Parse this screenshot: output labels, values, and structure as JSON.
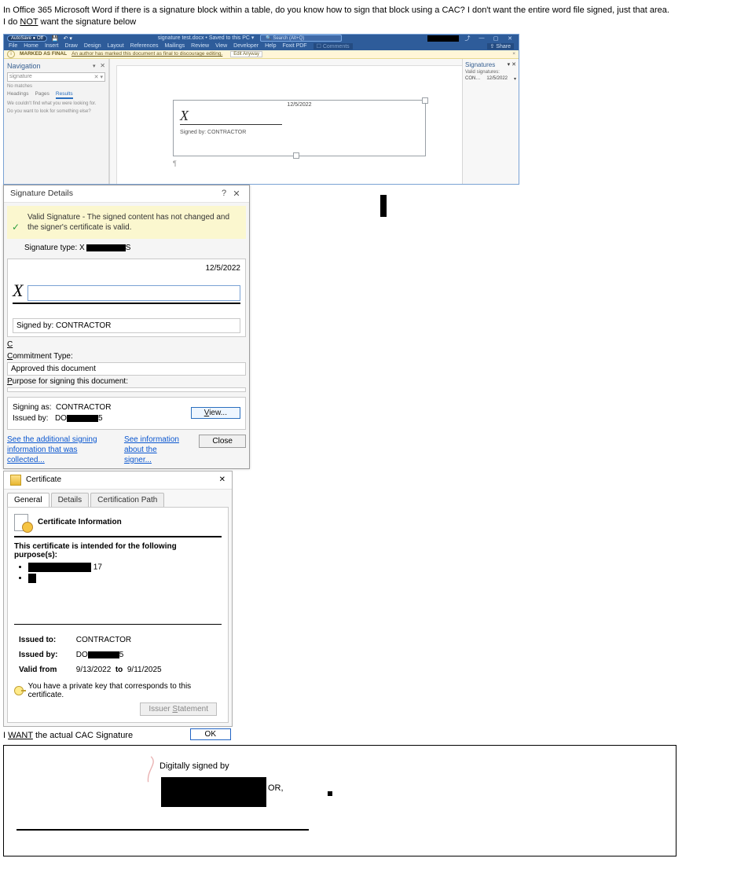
{
  "intro": {
    "line1": "In Office 365 Microsoft Word if there is a signature block within a table, do you know how to sign that block using a CAC? I don't want the entire word file signed, just that area.",
    "line2a": "I do ",
    "line2b": "NOT",
    "line2c": " want the signature below"
  },
  "word": {
    "autosave": "AutoSave ● Off",
    "doc_title": "signature test.docx • Saved to this PC ▾",
    "search_placeholder": "Search (Alt+Q)",
    "window_min": "—",
    "window_max": "▢",
    "window_close": "✕",
    "share_icon_label": "⤴",
    "ribbon": [
      "File",
      "Home",
      "Insert",
      "Draw",
      "Design",
      "Layout",
      "References",
      "Mailings",
      "Review",
      "View",
      "Developer",
      "Help",
      "Foxit PDF"
    ],
    "comments": "☐ Comments",
    "share": "⇪ Share",
    "marked_final_label": "MARKED AS FINAL",
    "marked_final_text": "An author has marked this document as final to discourage editing.",
    "edit_anyway": "Edit Anyway",
    "info_icon": "i",
    "close_x": "×",
    "nav": {
      "title": "Navigation",
      "chevron": "▾",
      "close": "✕",
      "search_value": "signature",
      "search_clear": "✕ ▾",
      "no_matches": "No matches",
      "tabs": {
        "headings": "Headings",
        "pages": "Pages",
        "results": "Results"
      },
      "msg1": "We couldn't find what you were looking for.",
      "msg2": "Do you want to look for something else?"
    },
    "sigpane": {
      "title": "Signatures",
      "chevron": "▾",
      "close": "✕",
      "valid_label": "Valid signatures:",
      "name": "CON…",
      "date": "12/5/2022",
      "row_chevron": "▾"
    },
    "sigblock": {
      "date": "12/5/2022",
      "x": "X",
      "signed_by": "Signed by: CONTRACTOR",
      "para": "¶"
    }
  },
  "sigdetails": {
    "title": "Signature Details",
    "help": "?",
    "close": "✕",
    "valid_icon": "✓",
    "valid_text": "Valid Signature - The signed content has not changed and the signer's certificate is valid.",
    "sig_type_label": "Signature type: X",
    "sig_type_tail": "S",
    "date": "12/5/2022",
    "x": "X",
    "signed_by": "Signed by: CONTRACTOR",
    "commitment_label": "Commitment Type:",
    "commitment_value": "Approved this document",
    "purpose_label": "Purpose for signing this document:",
    "purpose_value": "",
    "signing_as_label": "Signing as:",
    "signing_as_value": "CONTRACTOR",
    "issued_by_label": "Issued by:",
    "issued_by_prefix": "DO",
    "issued_by_tail": "5",
    "view_btn": "View...",
    "link1": "See the additional signing information that was collected...",
    "link2": "See information about the signer...",
    "close_btn": "Close"
  },
  "cert": {
    "title": "Certificate",
    "close": "✕",
    "tabs": {
      "general": "General",
      "details": "Details",
      "path": "Certification Path"
    },
    "info_head": "Certificate Information",
    "purpose_intro": "This certificate is intended for the following purpose(s):",
    "purpose_tail": "17",
    "issued_to_label": "Issued to:",
    "issued_to_value": "CONTRACTOR",
    "issued_by_label": "Issued by:",
    "issued_by_prefix": "DO",
    "issued_by_tail": "5",
    "valid_from_label": "Valid from",
    "valid_from": "9/13/2022",
    "valid_to_label": "to",
    "valid_to": "9/11/2025",
    "key_msg": "You have a private key that corresponds to this certificate.",
    "issuer_btn": "Issuer Statement",
    "ok_btn": "OK"
  },
  "want": {
    "prefix": "I ",
    "want": "WANT",
    "suffix": " the actual CAC Signature"
  },
  "desired": {
    "digitally_signed": "Digitally signed by",
    "right_text": "OR,"
  }
}
